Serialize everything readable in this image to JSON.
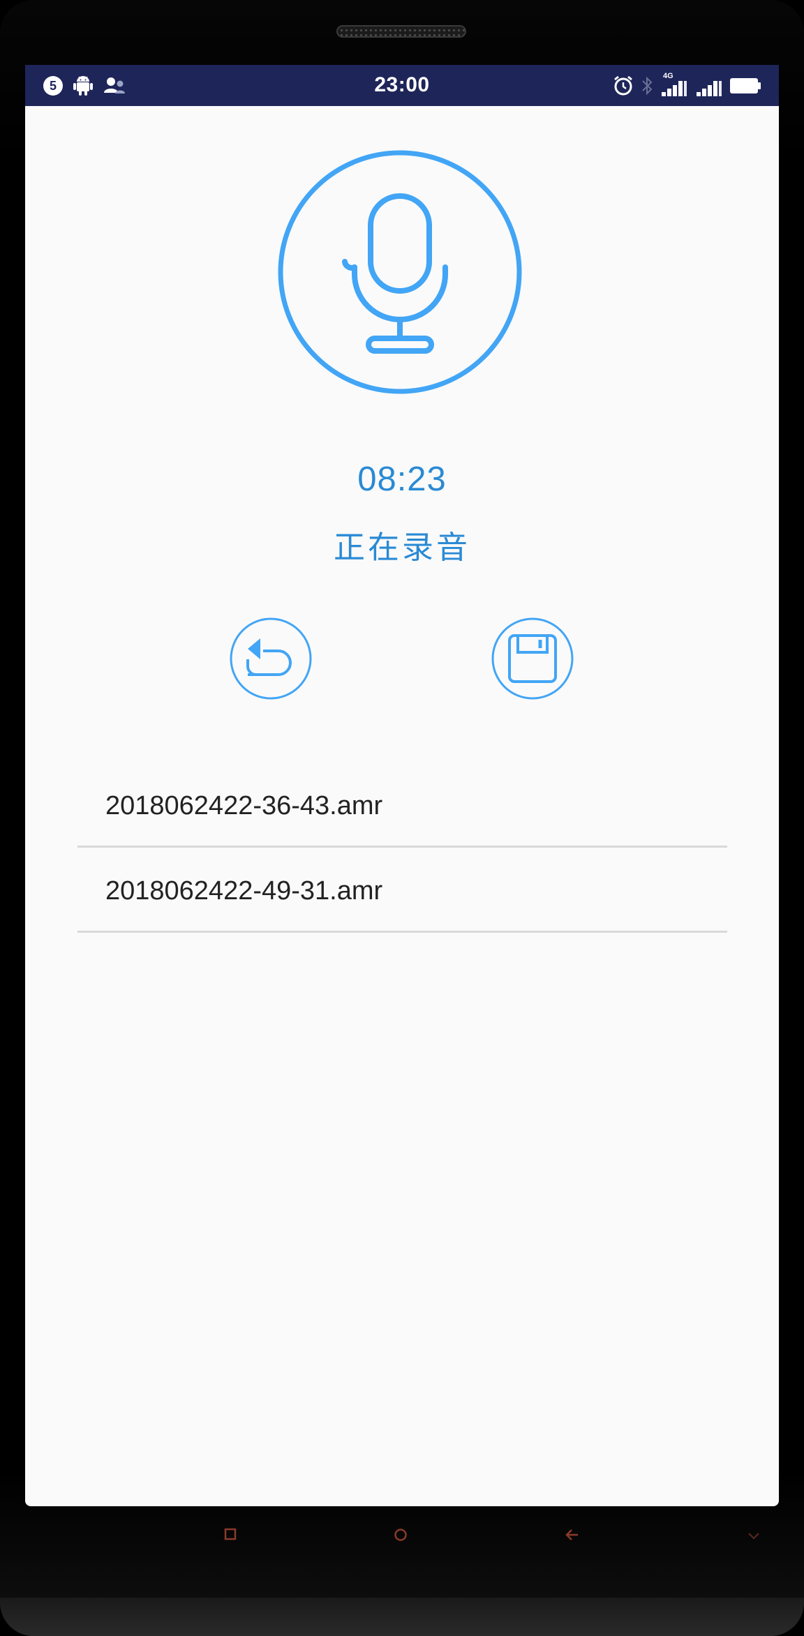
{
  "status_bar": {
    "notification_count": "5",
    "time": "23:00",
    "network_label": "4G"
  },
  "recorder": {
    "timer": "08:23",
    "status": "正在录音"
  },
  "files": [
    {
      "name": "2018062422-36-43.amr"
    },
    {
      "name": "2018062422-49-31.amr"
    }
  ],
  "colors": {
    "accent": "#42a5f5",
    "text_accent": "#2a8ad4",
    "status_bar": "#1e2559",
    "nav_icon": "#8a3a2a"
  },
  "icons": {
    "mic": "microphone-icon",
    "back": "undo-icon",
    "save": "floppy-disk-icon"
  }
}
